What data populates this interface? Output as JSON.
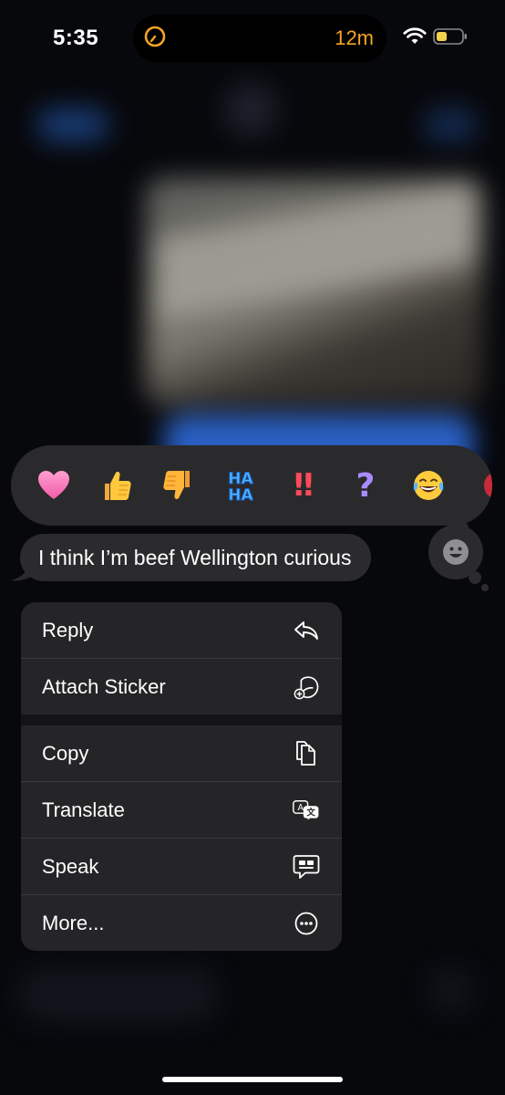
{
  "status_bar": {
    "time": "5:35",
    "activity_timer": "12m",
    "accent_color": "#f5a524"
  },
  "reactions": [
    {
      "name": "heart-reaction",
      "icon": "pink-heart"
    },
    {
      "name": "thumbs-up-reaction",
      "icon": "thumbs-up"
    },
    {
      "name": "thumbs-down-reaction",
      "icon": "thumbs-down"
    },
    {
      "name": "haha-reaction",
      "icon": "haha",
      "text_top": "HA",
      "text_bottom": "HA"
    },
    {
      "name": "exclamation-reaction",
      "icon": "double-exclamation",
      "text": "‼"
    },
    {
      "name": "question-reaction",
      "icon": "question-mark",
      "text": "?"
    },
    {
      "name": "laughing-face-reaction",
      "icon": "tears-of-joy"
    },
    {
      "name": "more-emoji-reaction",
      "icon": "partial-emoji"
    }
  ],
  "message": {
    "text": "I think I’m beef Wellington curious"
  },
  "menu": {
    "items": [
      {
        "label": "Reply",
        "icon": "reply-arrow-icon"
      },
      {
        "label": "Attach Sticker",
        "icon": "sticker-add-icon"
      },
      {
        "label": "Copy",
        "icon": "copy-icon"
      },
      {
        "label": "Translate",
        "icon": "translate-icon"
      },
      {
        "label": "Speak",
        "icon": "speak-bubble-icon"
      },
      {
        "label": "More...",
        "icon": "ellipsis-circle-icon"
      }
    ]
  }
}
